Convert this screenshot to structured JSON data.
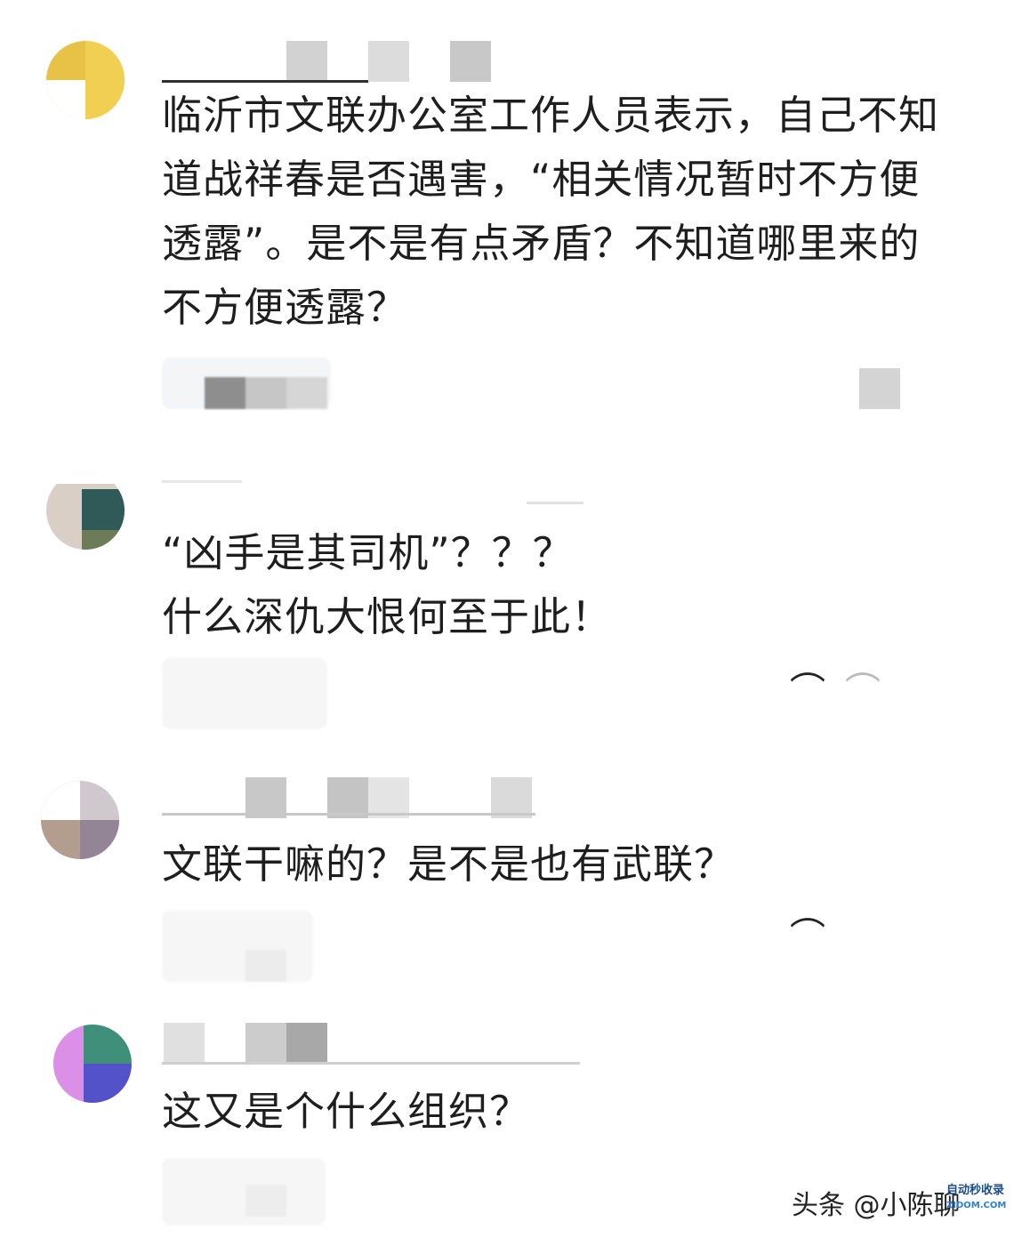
{
  "comments": [
    {
      "lines": [
        "临沂市文联办公室工作人员表示，自己不知",
        "道战祥春是否遇害，“相关情况暂时不方便",
        "透露”。是不是有点矛盾？不知道哪里来的",
        "不方便透露？"
      ]
    },
    {
      "lines": [
        "“凶手是其司机”？？？",
        "什么深仇大恨何至于此！"
      ],
      "like_icon": "like-icon"
    },
    {
      "lines": [
        "文联干嘛的？是不是也有武联？"
      ],
      "like_icon": "like-icon"
    },
    {
      "lines": [
        "这又是个什么组织？"
      ]
    }
  ],
  "watermark": {
    "text": "头条 @小陈聊",
    "logo_line1": "自动秒收录",
    "logo_line2": "ZIDOM.COM"
  },
  "colors": {
    "text": "#1e1e1e",
    "mosaic_light": "#e6e6e6",
    "mosaic_mid": "#cfcfcf",
    "mosaic_dark": "#8c8c8c"
  }
}
